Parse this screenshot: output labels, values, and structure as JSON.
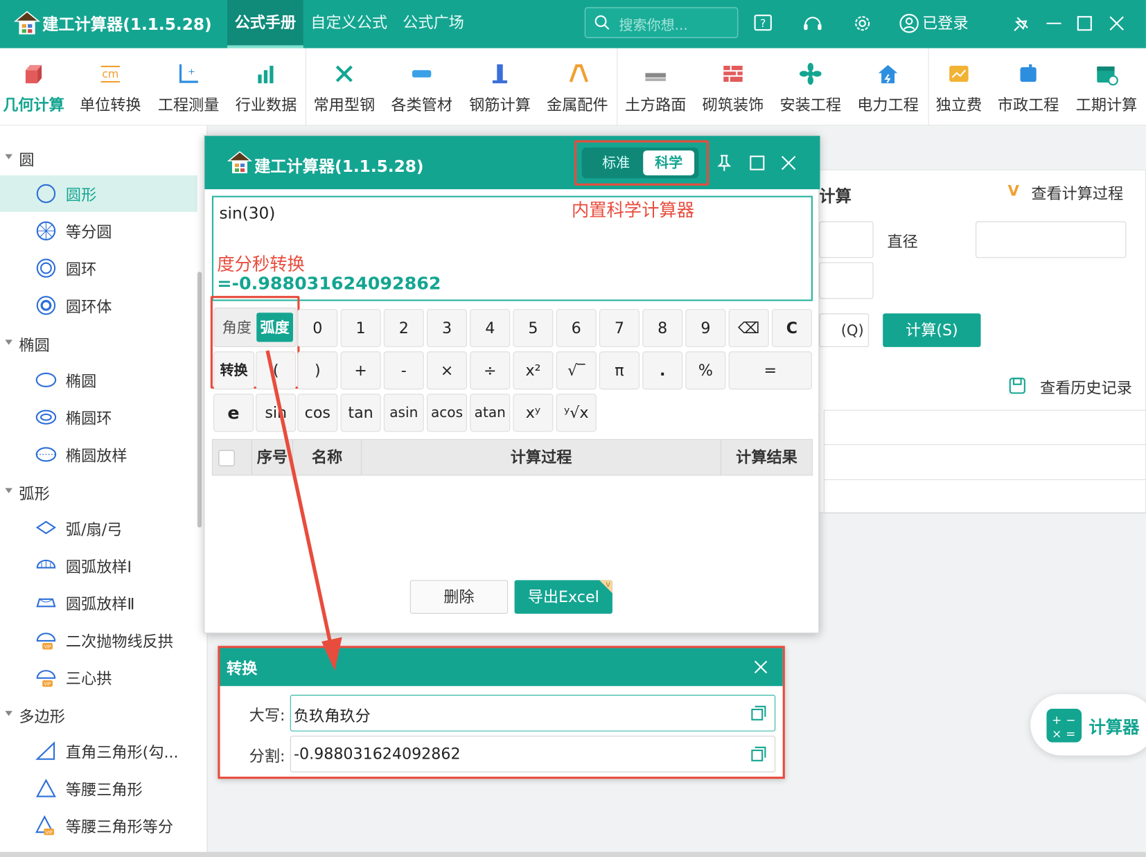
{
  "app": {
    "title": "建工计算器(1.1.5.28)"
  },
  "nav": {
    "tabs": [
      "公式手册",
      "自定义公式",
      "公式广场"
    ],
    "search_placeholder": "搜索你想...",
    "login": "已登录"
  },
  "toolbar": {
    "items": [
      "几何计算",
      "单位转换",
      "工程测量",
      "行业数据",
      "常用型钢",
      "各类管材",
      "钢筋计算",
      "金属配件",
      "土方路面",
      "砌筑装饰",
      "安装工程",
      "电力工程",
      "独立费",
      "市政工程",
      "工期计算"
    ]
  },
  "sidebar": {
    "groups": [
      {
        "label": "圆",
        "items": [
          "圆形",
          "等分圆",
          "圆环",
          "圆环体"
        ]
      },
      {
        "label": "椭圆",
        "items": [
          "椭圆",
          "椭圆环",
          "椭圆放样"
        ]
      },
      {
        "label": "弧形",
        "items": [
          "弧/扇/弓",
          "圆弧放样Ⅰ",
          "圆弧放样Ⅱ",
          "二次抛物线反拱",
          "三心拱"
        ]
      },
      {
        "label": "多边形",
        "items": [
          "直角三角形(勾...",
          "等腰三角形",
          "等腰三角形等分"
        ]
      }
    ]
  },
  "main": {
    "section_title": "计算",
    "view_process": "查看计算过程",
    "diameter_label": "直径",
    "clear_btn_partial": "(Q)",
    "calc_btn": "计算(S)",
    "history_link": "查看历史记录"
  },
  "calculator": {
    "title": "建工计算器(1.1.5.28)",
    "mode_std": "标准",
    "mode_sci": "科学",
    "annotation_sci": "内置科学计算器",
    "expression": "sin(30)",
    "annotation_dms": "度分秒转换",
    "result": "=-0.988031624092862",
    "unit_deg": "角度",
    "unit_rad": "弧度",
    "row1": [
      "0",
      "1",
      "2",
      "3",
      "4",
      "5",
      "6",
      "7",
      "8",
      "9",
      "⌫",
      "C"
    ],
    "row2": [
      "转换",
      "(",
      ")",
      "+",
      "-",
      "×",
      "÷",
      "x²",
      "√‾",
      "π",
      ".",
      "%",
      "="
    ],
    "row3": [
      "e",
      "sin",
      "cos",
      "tan",
      "asin",
      "acos",
      "atan",
      "xʸ",
      "ʸ√x"
    ],
    "table_headers": [
      "序号",
      "名称",
      "计算过程",
      "计算结果"
    ],
    "delete_btn": "删除",
    "export_btn": "导出Excel"
  },
  "convert": {
    "title": "转换",
    "upper_label": "大写:",
    "upper_value": "负玖角玖分",
    "split_label": "分割:",
    "split_value": "-0.988031624092862"
  },
  "float_button": {
    "label": "计算器"
  },
  "colors": {
    "primary": "#14a591",
    "annotation": "#e84c3d"
  }
}
